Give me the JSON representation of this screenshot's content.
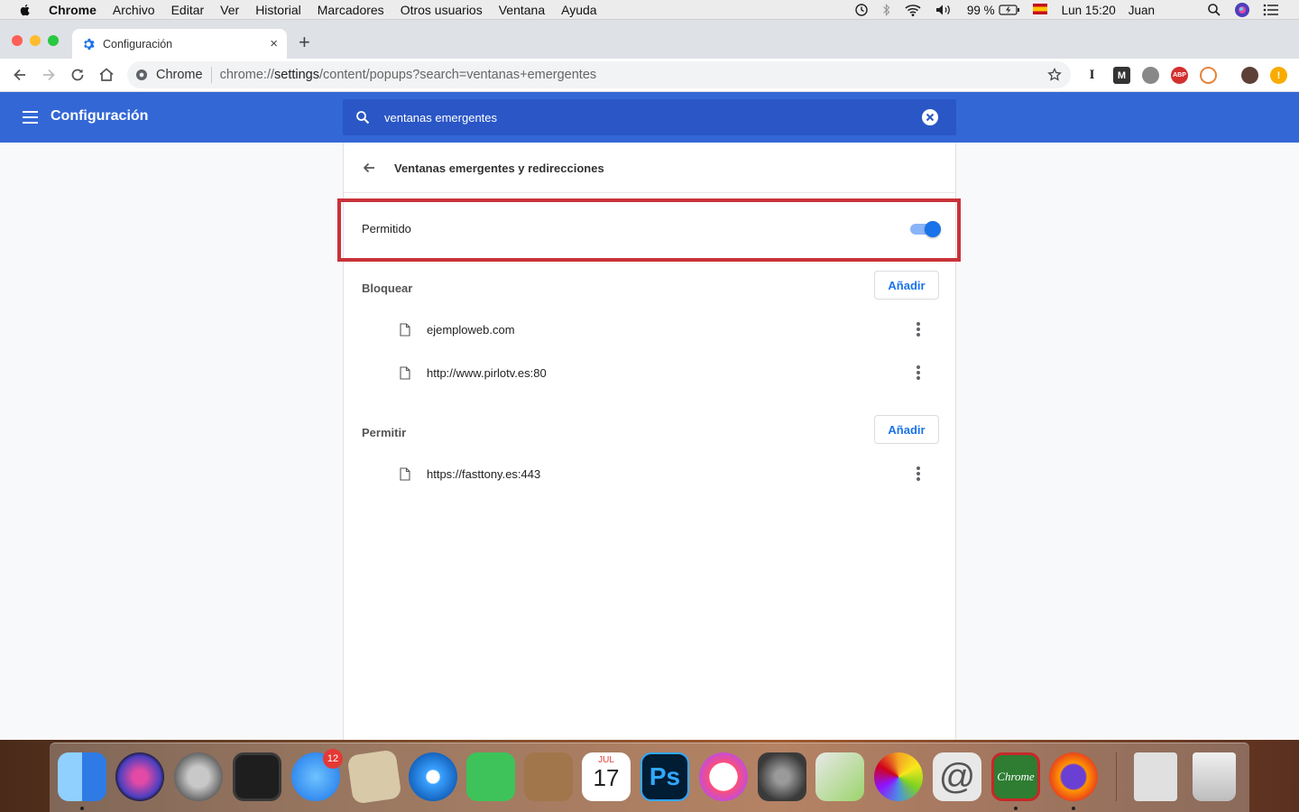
{
  "menubar": {
    "app_name": "Chrome",
    "items": [
      "Archivo",
      "Editar",
      "Ver",
      "Historial",
      "Marcadores",
      "Otros usuarios",
      "Ventana",
      "Ayuda"
    ],
    "battery": "99 %",
    "clock": "Lun 15:20",
    "user": "Juan"
  },
  "browser": {
    "tab_title": "Configuración",
    "new_tab": "+",
    "close_tab": "×",
    "omnibox_label": "Chrome",
    "url_scheme": "chrome://",
    "url_host": "settings",
    "url_rest": "/content/popups?search=ventanas+emergentes"
  },
  "settings": {
    "title": "Configuración",
    "search_value": "ventanas emergentes",
    "page_title": "Ventanas emergentes y redirecciones",
    "allowed_label": "Permitido",
    "allowed_enabled": true,
    "block_section": {
      "label": "Bloquear",
      "add_label": "Añadir",
      "sites": [
        "ejemploweb.com",
        "http://www.pirlotv.es:80"
      ]
    },
    "allow_section": {
      "label": "Permitir",
      "add_label": "Añadir",
      "sites": [
        "https://fasttony.es:443"
      ]
    }
  },
  "dock": {
    "app_store_badge": "12",
    "calendar_month": "JUL",
    "calendar_day": "17",
    "photoshop_label": "Ps",
    "mail_label": "@",
    "chrome_label": "Chrome"
  },
  "colors": {
    "header_blue": "#3367d6",
    "search_blue": "#2a56c6",
    "link_blue": "#1a73e8",
    "highlight_red": "#c9323a"
  }
}
